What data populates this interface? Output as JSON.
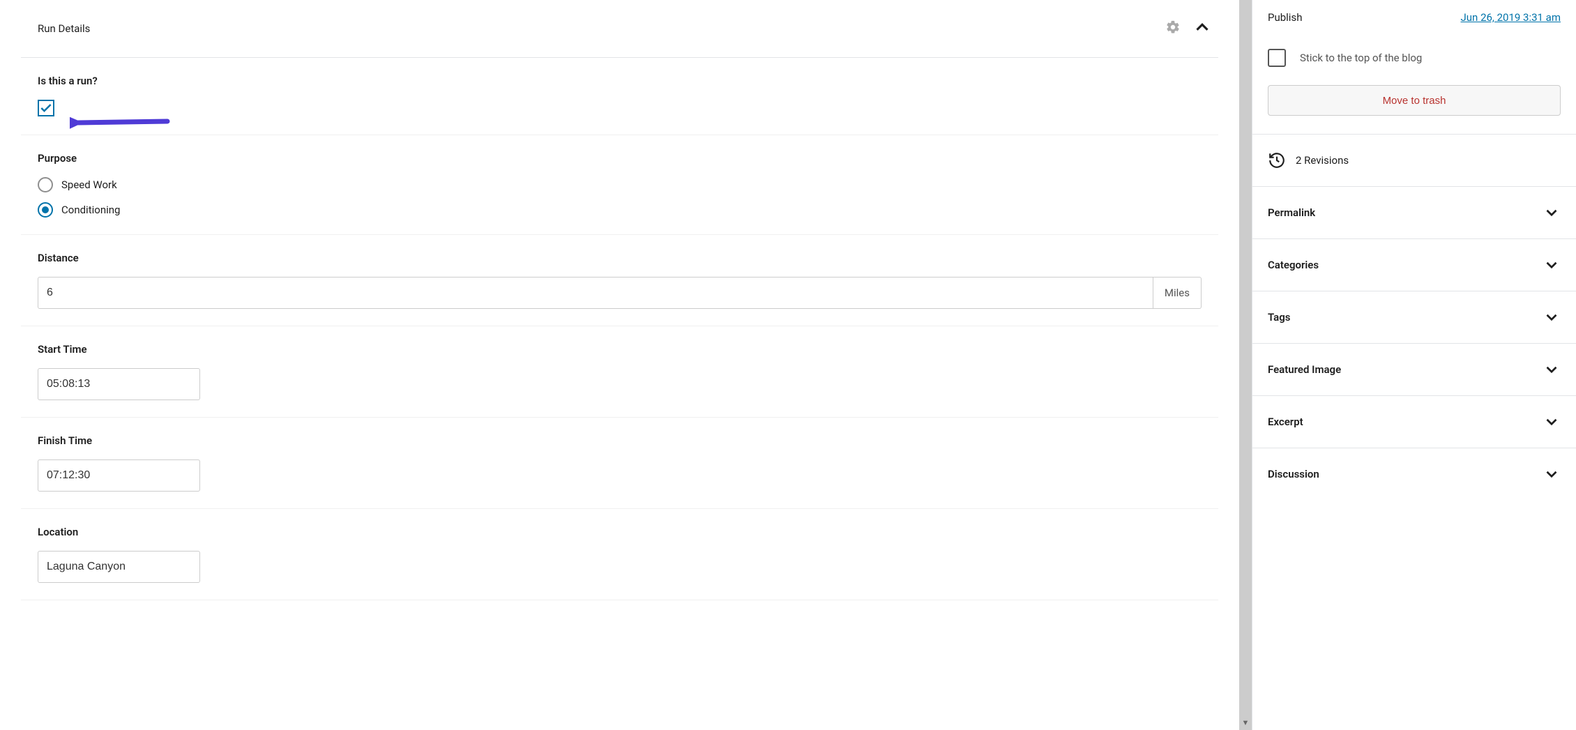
{
  "panel": {
    "title": "Run Details"
  },
  "fields": {
    "is_run": {
      "label": "Is this a run?",
      "checked": true
    },
    "purpose": {
      "label": "Purpose",
      "options": [
        "Speed Work",
        "Conditioning"
      ],
      "selected": "Conditioning"
    },
    "distance": {
      "label": "Distance",
      "value": "6",
      "unit": "Miles"
    },
    "start_time": {
      "label": "Start Time",
      "value": "05:08:13"
    },
    "finish_time": {
      "label": "Finish Time",
      "value": "07:12:30"
    },
    "location": {
      "label": "Location",
      "value": "Laguna Canyon"
    }
  },
  "sidebar": {
    "publish": {
      "label": "Publish",
      "date": "Jun 26, 2019 3:31 am"
    },
    "stick": {
      "label": "Stick to the top of the blog",
      "checked": false
    },
    "trash_label": "Move to trash",
    "revisions": {
      "count": "2",
      "label": "2 Revisions"
    },
    "panels": [
      "Permalink",
      "Categories",
      "Tags",
      "Featured Image",
      "Excerpt",
      "Discussion"
    ]
  }
}
